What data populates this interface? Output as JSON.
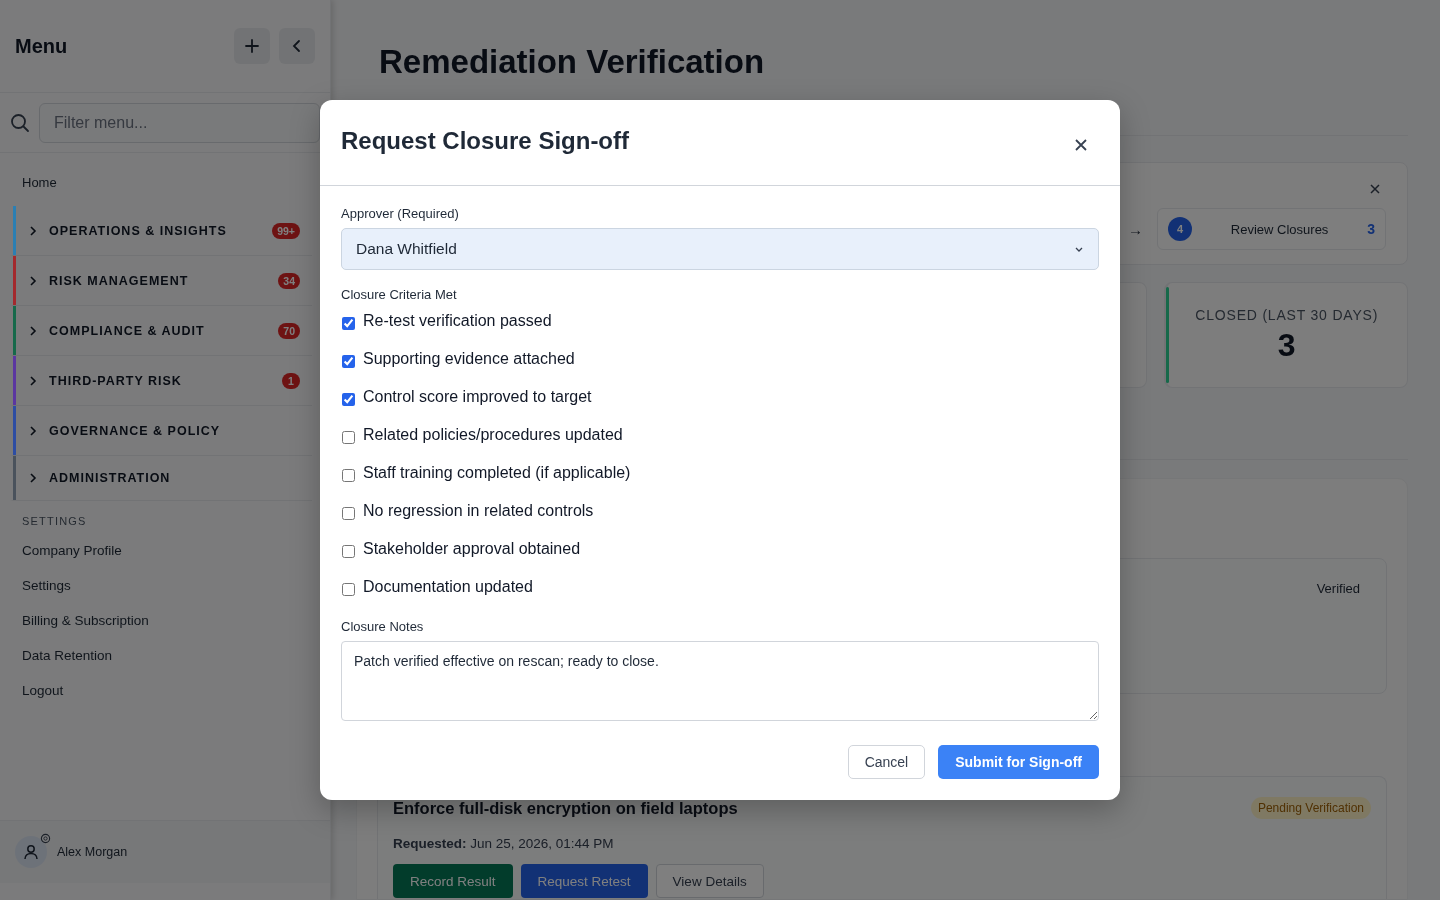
{
  "sidebar": {
    "title": "Menu",
    "filter_placeholder": "Filter menu...",
    "home": "Home",
    "sections": [
      {
        "label": "OPERATIONS & INSIGHTS",
        "badge": "99+",
        "color": "#2b7fb3",
        "expanded": false
      },
      {
        "label": "RISK MANAGEMENT",
        "badge": "34",
        "color": "#a3292d",
        "expanded": false
      },
      {
        "label": "COMPLIANCE & AUDIT",
        "badge": "70",
        "color": "#16694a",
        "expanded": false
      },
      {
        "label": "THIRD-PARTY RISK",
        "badge": "1",
        "color": "#5b36a0",
        "expanded": false
      },
      {
        "label": "GOVERNANCE & POLICY",
        "color": "#2d4da3",
        "expanded": false
      },
      {
        "label": "ADMINISTRATION",
        "color": "#4a525c",
        "expanded": false
      }
    ],
    "settings_heading": "SETTINGS",
    "settings_items": [
      "Company Profile",
      "Settings",
      "Billing & Subscription",
      "Data Retention",
      "Logout"
    ],
    "user": "Alex Morgan"
  },
  "page": {
    "title": "Remediation Verification",
    "workflow": {
      "arrow": "→",
      "step_number": "4",
      "step_label": "Review Closures",
      "step_count": "3"
    },
    "stats": [
      {
        "label": "CLOSED (LAST 30 DAYS)",
        "value": "3",
        "color": "#16694a"
      }
    ],
    "verified_status": "Verified",
    "request": {
      "title": "Enforce full-disk encryption on field laptops",
      "status": "Pending Verification",
      "requested_label": "Requested:",
      "requested_value": "Jun 25, 2026, 01:44 PM",
      "buttons": [
        {
          "label": "Record Result",
          "kind": "success"
        },
        {
          "label": "Request Retest",
          "kind": "primary"
        },
        {
          "label": "View Details",
          "kind": "outline"
        }
      ]
    }
  },
  "modal": {
    "title": "Request Closure Sign-off",
    "approver_label": "Approver (Required)",
    "approver_value": "Dana Whitfield",
    "criteria_label": "Closure Criteria Met",
    "criteria": [
      {
        "label": "Re-test verification passed",
        "checked": true
      },
      {
        "label": "Supporting evidence attached",
        "checked": true
      },
      {
        "label": "Control score improved to target",
        "checked": true
      },
      {
        "label": "Related policies/procedures updated",
        "checked": false
      },
      {
        "label": "Staff training completed (if applicable)",
        "checked": false
      },
      {
        "label": "No regression in related controls",
        "checked": false
      },
      {
        "label": "Stakeholder approval obtained",
        "checked": false
      },
      {
        "label": "Documentation updated",
        "checked": false
      }
    ],
    "notes_label": "Closure Notes",
    "notes_value": "Patch verified effective on rescan; ready to close.",
    "buttons": [
      {
        "label": "Cancel",
        "kind": "outline"
      },
      {
        "label": "Submit for Sign-off",
        "kind": "primary"
      }
    ]
  }
}
